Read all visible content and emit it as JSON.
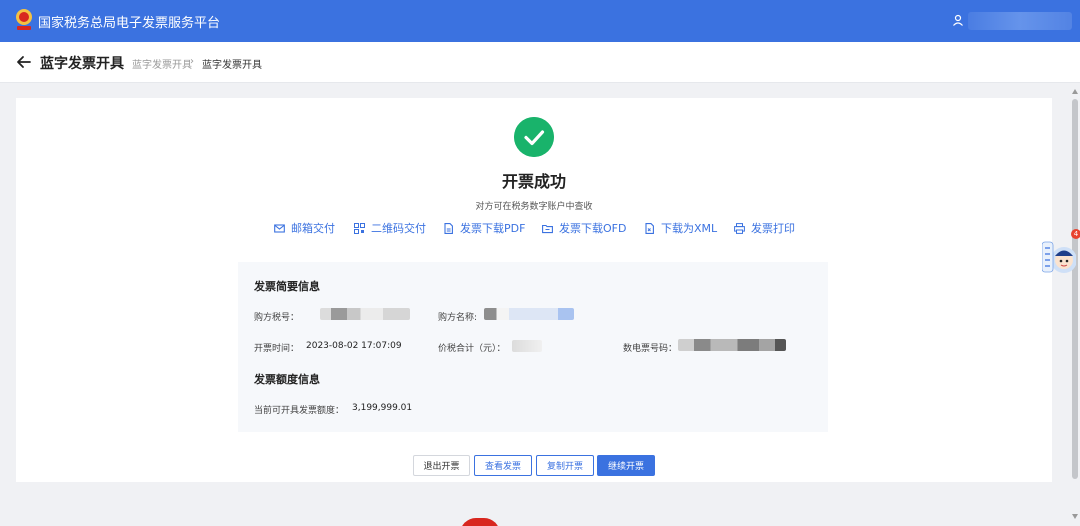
{
  "header": {
    "site_title": "国家税务总局电子发票服务平台",
    "brand_color": "#3b72e0"
  },
  "page": {
    "title": "蓝字发票开具",
    "breadcrumb": [
      "蓝字发票开具",
      "›",
      "蓝字发票开具"
    ]
  },
  "result": {
    "title": "开票成功",
    "subtitle": "对方可在税务数字账户中查收",
    "status_color": "#19b36b"
  },
  "actions": [
    {
      "label": "邮箱交付",
      "icon": "mail-icon"
    },
    {
      "label": "二维码交付",
      "icon": "qrcode-icon"
    },
    {
      "label": "发票下载PDF",
      "icon": "file-pdf-icon"
    },
    {
      "label": "发票下载OFD",
      "icon": "file-ofd-icon"
    },
    {
      "label": "下载为XML",
      "icon": "file-xml-icon"
    },
    {
      "label": "发票打印",
      "icon": "printer-icon"
    }
  ],
  "summary": {
    "section_title": "发票简要信息",
    "buyer_tax_id_label": "购方税号：",
    "buyer_name_label": "购方名称:",
    "issue_time_label": "开票时间：",
    "issue_time_value": "2023-08-02 17:07:09",
    "total_label": "价税合计（元）：",
    "invoice_no_label": "数电票号码："
  },
  "quota": {
    "section_title": "发票额度信息",
    "available_label": "当前可开具发票额度：",
    "available_value": "3,199,999.01"
  },
  "buttons": {
    "quit": "退出开票",
    "view": "查看发票",
    "copy": "复制开票",
    "continue": "继续开票"
  },
  "assistant": {
    "badge": "4"
  }
}
